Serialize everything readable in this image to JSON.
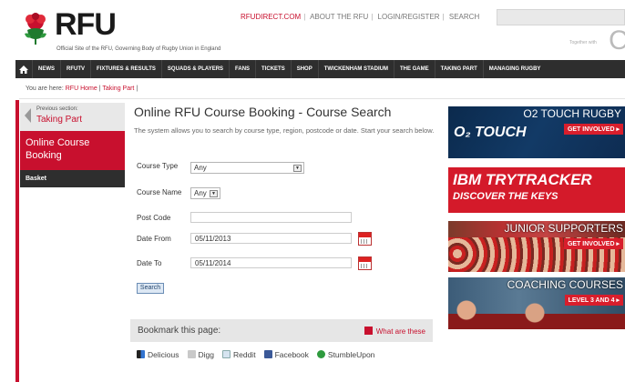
{
  "header": {
    "logo_text": "RFU",
    "tagline": "Official Site of the RFU, Governing Body of Rugby Union in England",
    "top_links": [
      "RFUDIRECT.COM",
      "ABOUT THE RFU",
      "LOGIN/REGISTER",
      "SEARCH"
    ],
    "together": "Together with",
    "together_logo": "C"
  },
  "nav": {
    "items": [
      "NEWS",
      "RFUTV",
      "FIXTURES & RESULTS",
      "SQUADS & PLAYERS",
      "FANS",
      "TICKETS",
      "SHOP",
      "TWICKENHAM STADIUM",
      "THE GAME",
      "TAKING PART",
      "MANAGING RUGBY"
    ]
  },
  "breadcrumb": {
    "prefix": "You are here:",
    "home": "RFU Home",
    "sep": "|",
    "current": "Taking Part",
    "end": "|"
  },
  "sidebar": {
    "prev_label": "Previous section:",
    "prev_link": "Taking Part",
    "active": "Online Course Booking",
    "basket": "Basket"
  },
  "main": {
    "title": "Online RFU Course Booking - Course Search",
    "description": "The system allows you to search by course type, region, postcode or date. Start your search below.",
    "fields": {
      "course_type_label": "Course Type",
      "course_type_value": "Any",
      "course_name_label": "Course Name",
      "course_name_value": "Any",
      "post_code_label": "Post Code",
      "post_code_value": "",
      "date_from_label": "Date From",
      "date_from_value": "05/11/2013",
      "date_to_label": "Date To",
      "date_to_value": "05/11/2014"
    },
    "search_button": "Search",
    "bookmark_title": "Bookmark this page:",
    "what_are_these": "What are these",
    "social": [
      "Delicious",
      "Digg",
      "Reddit",
      "Facebook",
      "StumbleUpon"
    ]
  },
  "banners": {
    "o2_title": "O2 TOUCH RUGBY",
    "o2_logo": "O₂ TOUCH",
    "o2_button": "GET INVOLVED ▸",
    "ibm_line1": "IBM TRYTRACKER",
    "ibm_line2": "DISCOVER THE KEYS",
    "junior_title": "JUNIOR SUPPORTERS",
    "junior_button": "GET INVOLVED ▸",
    "coaching_title": "COACHING COURSES",
    "coaching_button": "LEVEL 3 AND 4 ▸"
  },
  "colors": {
    "brand_red": "#c8102e",
    "nav_bg": "#2e2e2e"
  }
}
